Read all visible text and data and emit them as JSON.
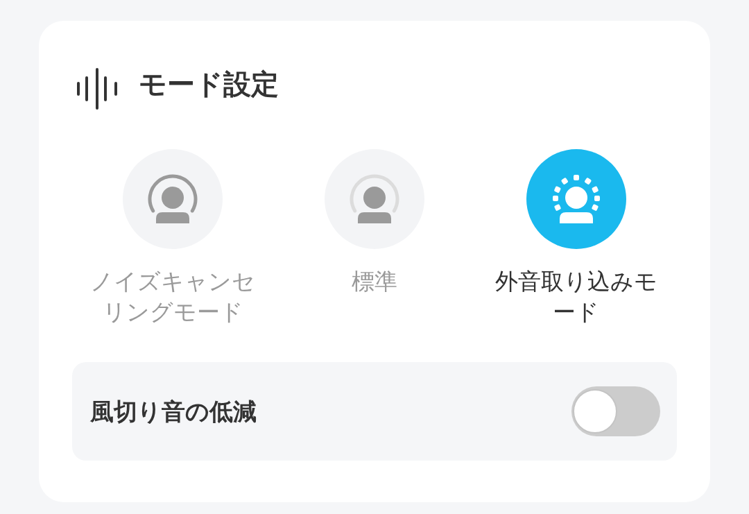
{
  "header": {
    "title": "モード設定"
  },
  "modes": [
    {
      "kind": "noise_cancelling",
      "label": "ノイズキャンセリングモード",
      "selected": false
    },
    {
      "kind": "normal",
      "label": "標準",
      "selected": false
    },
    {
      "kind": "ambient",
      "label": "外音取り込みモード",
      "selected": true
    }
  ],
  "wind_noise_reduction": {
    "label": "風切り音の低減",
    "on": false
  }
}
